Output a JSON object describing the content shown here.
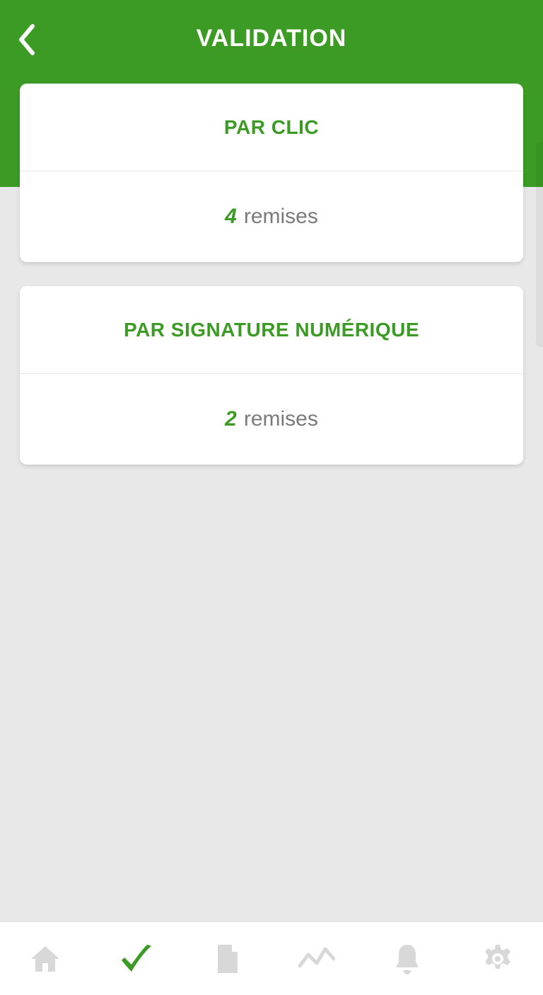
{
  "header": {
    "title": "VALIDATION"
  },
  "cards": [
    {
      "title": "PAR CLIC",
      "count": "4",
      "unit": "remises"
    },
    {
      "title": "PAR SIGNATURE NUMÉRIQUE",
      "count": "2",
      "unit": "remises"
    }
  ],
  "tabs": {
    "home": "home-icon",
    "validate": "check-icon",
    "document": "document-icon",
    "activity": "activity-icon",
    "alerts": "bell-icon",
    "settings": "gear-icon",
    "active": "validate"
  },
  "colors": {
    "brand": "#3b9b24",
    "bg": "#e8e8e8",
    "muted": "#d8d8d8",
    "text_muted": "#7a7a7a"
  }
}
